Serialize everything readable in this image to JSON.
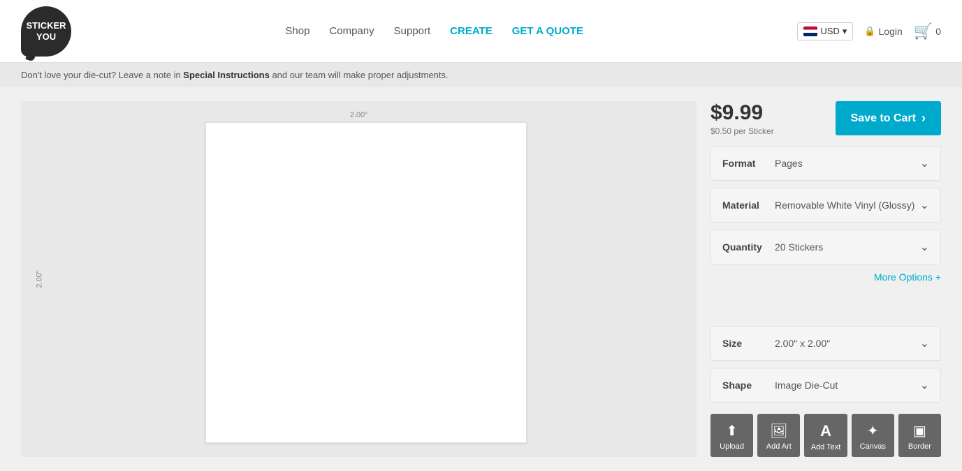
{
  "header": {
    "logo_line1": "STICKER",
    "logo_line2": "YOU",
    "currency": "USD",
    "nav_items": [
      {
        "label": "Shop",
        "id": "shop"
      },
      {
        "label": "Company",
        "id": "company"
      },
      {
        "label": "Support",
        "id": "support"
      },
      {
        "label": "CREATE",
        "id": "create",
        "highlight": true
      },
      {
        "label": "GET A QUOTE",
        "id": "quote",
        "highlight": true
      }
    ],
    "login_label": "Login",
    "cart_count": "0"
  },
  "notification": {
    "text_plain": "Don't love your die-cut? Leave a note in ",
    "text_bold": "Special Instructions",
    "text_plain2": " and our team will make proper adjustments."
  },
  "canvas": {
    "ruler_top": "2.00\"",
    "ruler_left": "2.00\""
  },
  "pricing": {
    "price": "$9.99",
    "per_sticker": "$0.50 per Sticker",
    "save_button": "Save to Cart"
  },
  "options": {
    "format_label": "Format",
    "format_value": "Pages",
    "material_label": "Material",
    "material_value": "Removable White Vinyl (Glossy)",
    "quantity_label": "Quantity",
    "quantity_value": "20 Stickers",
    "more_options": "More Options +",
    "size_label": "Size",
    "size_value": "2.00\" x 2.00\"",
    "shape_label": "Shape",
    "shape_value": "Image Die-Cut"
  },
  "tools": [
    {
      "label": "Upload",
      "icon": "⬆",
      "id": "upload"
    },
    {
      "label": "Add Art",
      "icon": "🖼",
      "id": "add-art"
    },
    {
      "label": "Add Text",
      "icon": "A",
      "id": "add-text"
    },
    {
      "label": "Canvas",
      "icon": "✦",
      "id": "canvas"
    },
    {
      "label": "Border",
      "icon": "▣",
      "id": "border"
    }
  ]
}
